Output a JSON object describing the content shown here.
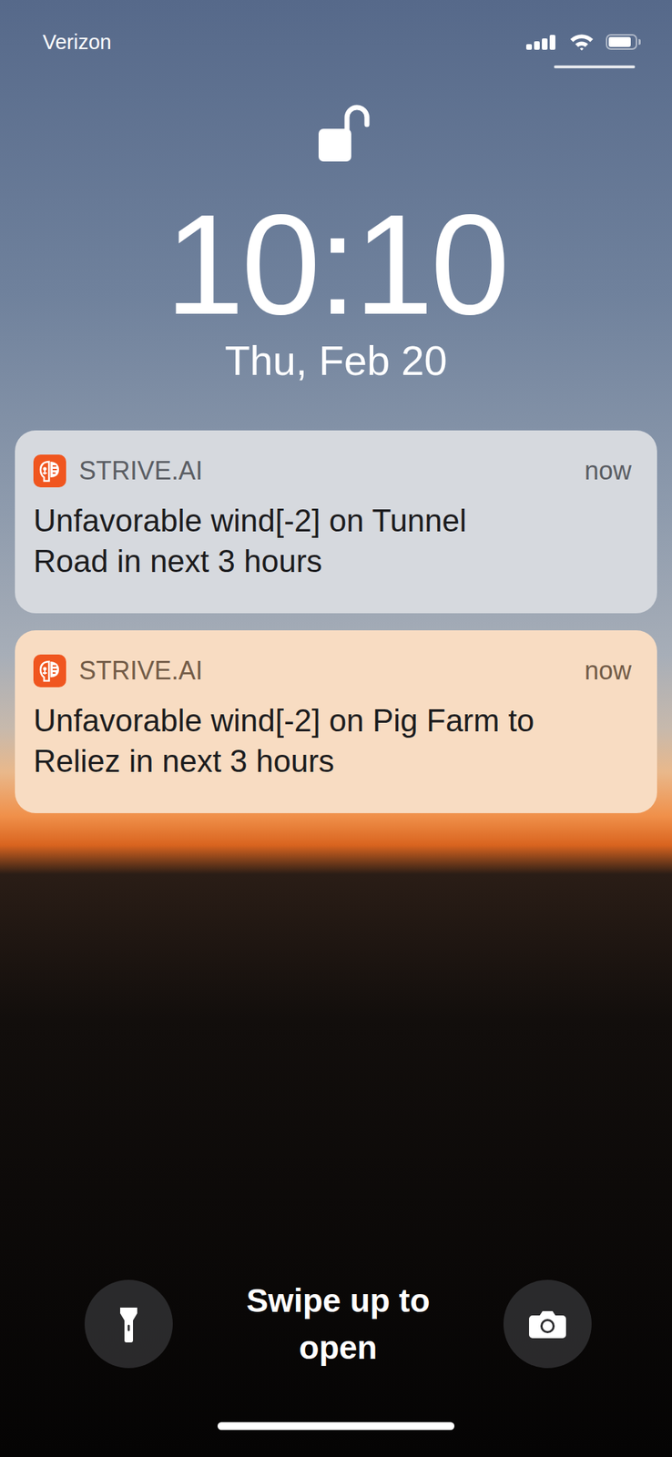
{
  "status_bar": {
    "carrier": "Verizon",
    "signal": {
      "level": 1
    },
    "wifi": {
      "on": true
    },
    "battery": {
      "level": 0.85
    }
  },
  "lock": {
    "unlocked": true
  },
  "clock": {
    "time": "10:10",
    "date": "Thu, Feb 20"
  },
  "notifications": [
    {
      "app": "STRIVE.AI",
      "time": "now",
      "message": "Unfavorable wind[-2] on Tunnel Road in next 3 hours"
    },
    {
      "app": "STRIVE.AI",
      "time": "now",
      "message": "Unfavorable wind[-2] on Pig Farm to Reliez in next 3 hours"
    }
  ],
  "bottom": {
    "swipe_hint": "Swipe up to open"
  }
}
